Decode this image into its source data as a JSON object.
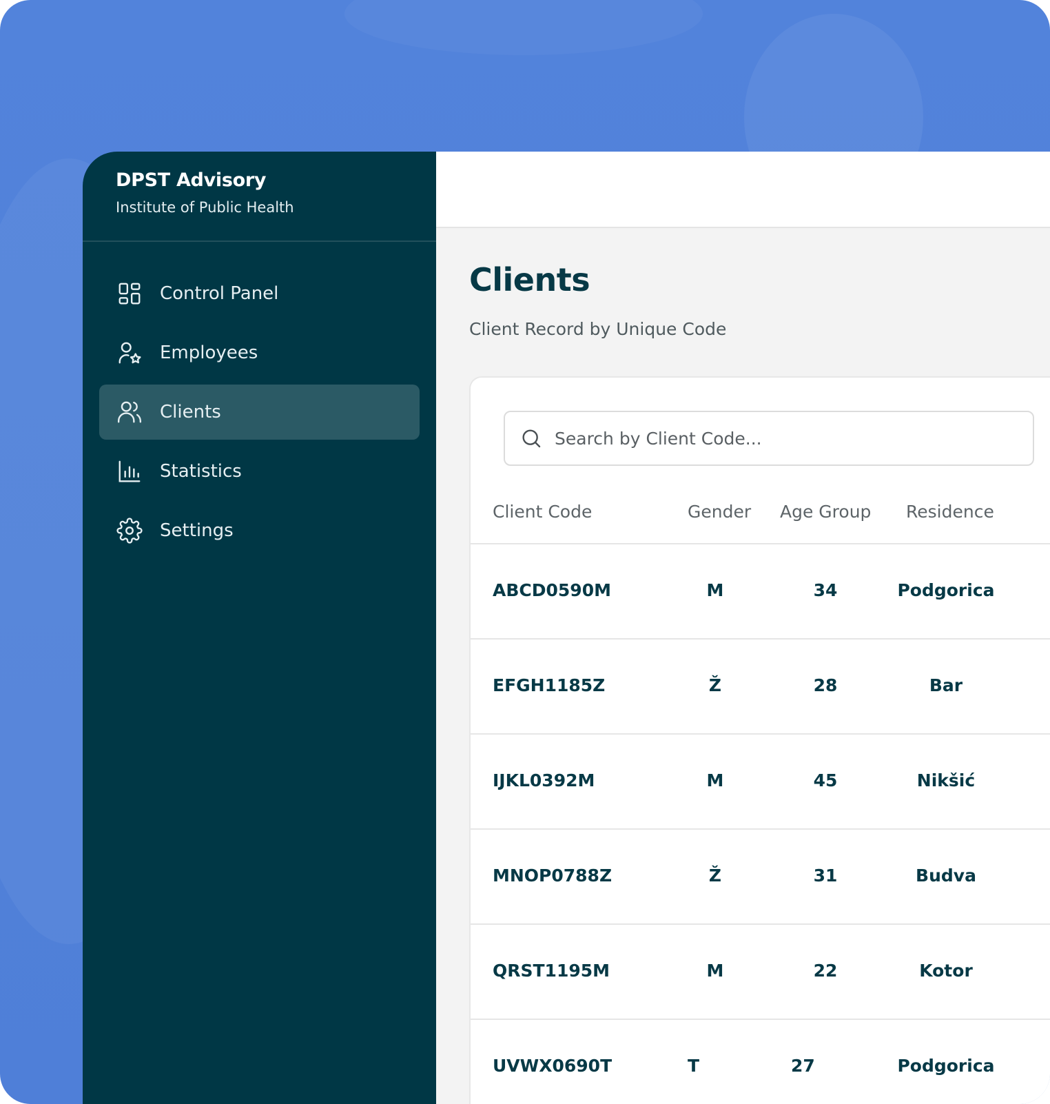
{
  "brand": {
    "title": "DPST Advisory",
    "subtitle": "Institute of Public Health"
  },
  "sidebar": {
    "items": [
      {
        "label": "Control Panel",
        "icon": "grid-icon",
        "active": false
      },
      {
        "label": "Employees",
        "icon": "user-star-icon",
        "active": false
      },
      {
        "label": "Clients",
        "icon": "users-icon",
        "active": true
      },
      {
        "label": "Statistics",
        "icon": "bar-chart-icon",
        "active": false
      },
      {
        "label": "Settings",
        "icon": "gear-icon",
        "active": false
      }
    ]
  },
  "page": {
    "title": "Clients",
    "subtitle": "Client Record by Unique Code"
  },
  "search": {
    "placeholder": "Search by Client Code...",
    "value": ""
  },
  "table": {
    "columns": [
      "Client Code",
      "Gender",
      "Age Group",
      "Residence"
    ],
    "rows": [
      {
        "code": "ABCD0590M",
        "gender": "M",
        "age": "34",
        "residence": "Podgorica"
      },
      {
        "code": "EFGH1185Z",
        "gender": "Ž",
        "age": "28",
        "residence": "Bar"
      },
      {
        "code": "IJKL0392M",
        "gender": "M",
        "age": "45",
        "residence": "Nikšić"
      },
      {
        "code": "MNOP0788Z",
        "gender": "Ž",
        "age": "31",
        "residence": "Budva"
      },
      {
        "code": "QRST1195M",
        "gender": "M",
        "age": "22",
        "residence": "Kotor"
      },
      {
        "code": "UVWX0690T",
        "gender": "T",
        "age": "27",
        "residence": "Podgorica"
      }
    ]
  },
  "colors": {
    "background": "#5283db",
    "sidebar": "#003745",
    "sidebar_active": "#2b5a65",
    "text_primary": "#073946"
  }
}
